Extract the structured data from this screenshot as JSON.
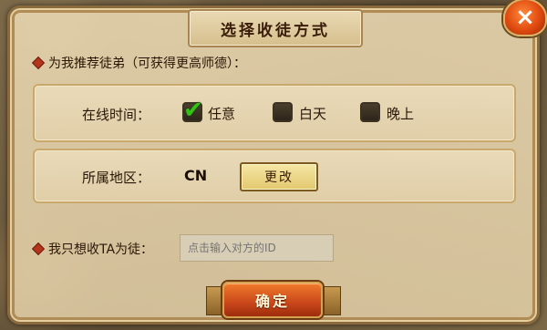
{
  "dialog": {
    "title": "选择收徒方式",
    "close_label": "×"
  },
  "recommend": {
    "heading": "为我推荐徒弟（可获得更高师德）：",
    "online_time": {
      "label": "在线时间：",
      "options": [
        {
          "label": "任意",
          "checked": true
        },
        {
          "label": "白天",
          "checked": false
        },
        {
          "label": "晚上",
          "checked": false
        }
      ]
    },
    "region": {
      "label": "所属地区：",
      "value": "CN",
      "change_label": "更改"
    }
  },
  "direct": {
    "label": "我只想收TA为徒：",
    "placeholder": "点击输入对方的ID",
    "value": ""
  },
  "confirm_label": "确定"
}
